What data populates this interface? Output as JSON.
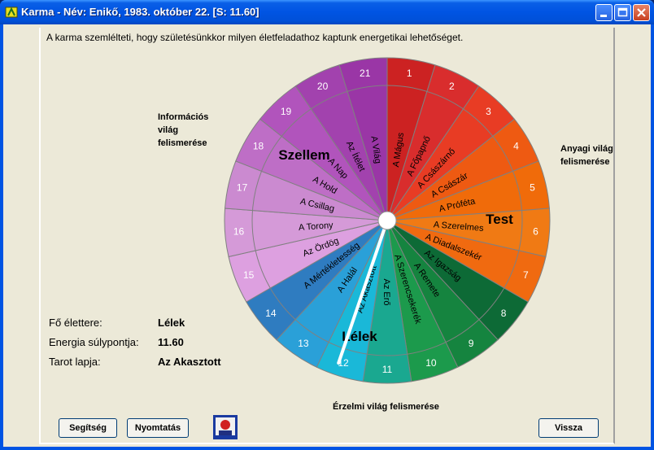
{
  "window": {
    "title": "Karma - Név: Enikő, 1983. október 22. [S: 11.60]"
  },
  "intro": "A karma szemlélteti, hogy születésünkkor milyen életfeladathoz kaptunk energetikai lehetőséget.",
  "labels": {
    "information": "Információs világ felismerése",
    "material": "Anyagi világ felismerése",
    "emotional": "Érzelmi világ felismerése"
  },
  "info": {
    "life_area_label": "Fő élettere:",
    "life_area": "Lélek",
    "energy_label": "Energia súlypontja:",
    "energy": "11.60",
    "tarot_label": "Tarot lapja:",
    "tarot": "Az Akasztott"
  },
  "wheel": {
    "sections": [
      "Szellem",
      "Test",
      "Lélek"
    ],
    "pointer_value": 11.6,
    "segments": [
      {
        "n": "1",
        "name": "A Mágus",
        "color": "#cc2222"
      },
      {
        "n": "2",
        "name": "A Főpapnő",
        "color": "#d92d2d"
      },
      {
        "n": "3",
        "name": "A Császárnő",
        "color": "#e83c24"
      },
      {
        "n": "4",
        "name": "A Császár",
        "color": "#ee5a12"
      },
      {
        "n": "5",
        "name": "A Próféta",
        "color": "#f06b0a"
      },
      {
        "n": "6",
        "name": "A Szerelmes",
        "color": "#f07a14"
      },
      {
        "n": "7",
        "name": "A Diadalszekér",
        "color": "#f06a10"
      },
      {
        "n": "8",
        "name": "Az Igazság",
        "color": "#0d6a36"
      },
      {
        "n": "9",
        "name": "A Remete",
        "color": "#15843f"
      },
      {
        "n": "10",
        "name": "A Szerencsekerék",
        "color": "#1c9a4c"
      },
      {
        "n": "11",
        "name": "Az Erő",
        "color": "#1aa890"
      },
      {
        "n": "12",
        "name": "Az Akasztott",
        "color": "#1ab8d8"
      },
      {
        "n": "13",
        "name": "A Halál",
        "color": "#2aa0d8"
      },
      {
        "n": "14",
        "name": "A Mértékletesség",
        "color": "#2f7cc0"
      },
      {
        "n": "15",
        "name": "Az Ördög",
        "color": "#dda0e0"
      },
      {
        "n": "16",
        "name": "A Torony",
        "color": "#d59ad8"
      },
      {
        "n": "17",
        "name": "A Csillag",
        "color": "#cb8ad0"
      },
      {
        "n": "18",
        "name": "A Hold",
        "color": "#be6ec6"
      },
      {
        "n": "19",
        "name": "A Nap",
        "color": "#b154bc"
      },
      {
        "n": "20",
        "name": "Az Ítélet",
        "color": "#a242ae"
      },
      {
        "n": "21",
        "name": "A Világ",
        "color": "#9a36a6"
      }
    ]
  },
  "buttons": {
    "help": "Segítség",
    "print": "Nyomtatás",
    "back": "Vissza"
  },
  "icons": {
    "app": "karma-app-icon",
    "print_preview": "print-preview-icon"
  }
}
